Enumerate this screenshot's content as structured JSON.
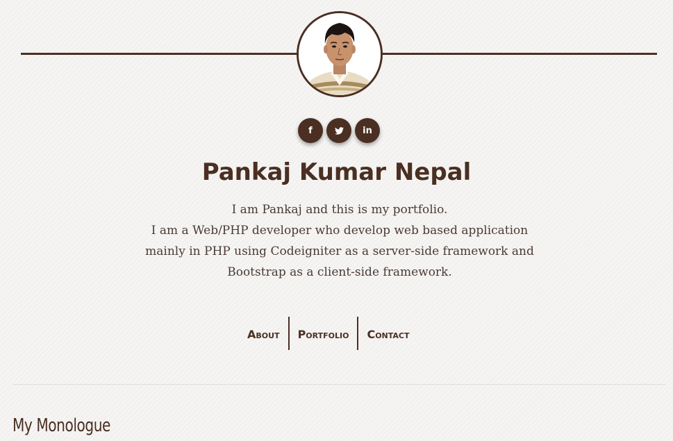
{
  "profile": {
    "name": "Pankaj Kumar Nepal",
    "avatar_alt": "profile-photo"
  },
  "social": [
    {
      "label": "f",
      "icon": "facebook-icon"
    },
    {
      "label": "🐦",
      "icon": "twitter-icon"
    },
    {
      "label": "in",
      "icon": "linkedin-icon"
    }
  ],
  "bio": {
    "line1": "I am Pankaj and this is my portfolio.",
    "line2": "I am a Web/PHP developer who develop web based application mainly in PHP using Codeigniter as a server-side framework and Bootstrap as a client-side framework."
  },
  "nav": {
    "about": "About",
    "portfolio": "Portfolio",
    "contact": "Contact"
  },
  "section": {
    "title": "My Monologue"
  },
  "colors": {
    "accent": "#4a2f22",
    "background": "#f2f1f0"
  }
}
